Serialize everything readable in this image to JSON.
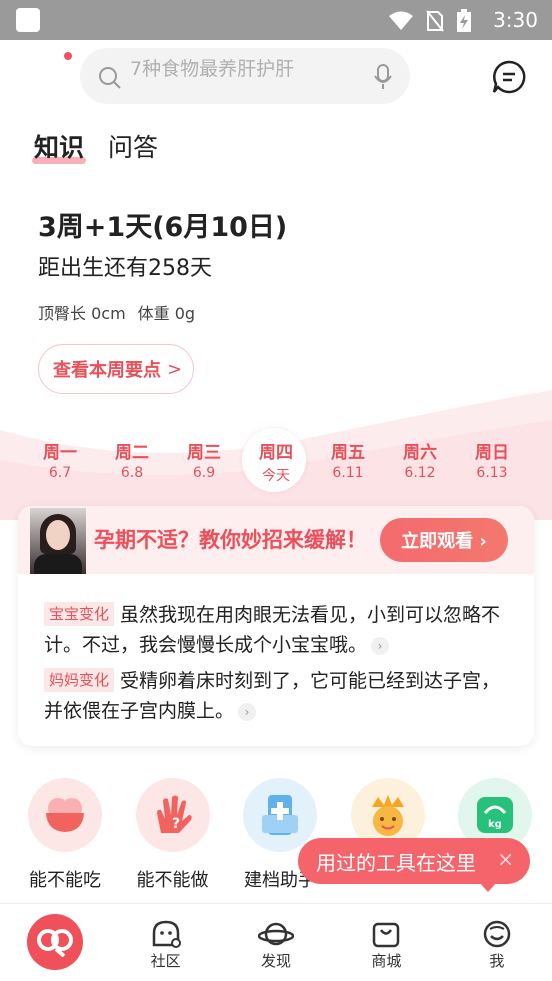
{
  "status_bar": {
    "time": "3:30"
  },
  "search": {
    "placeholder": "7种食物最养肝护肝"
  },
  "tabs": [
    {
      "label": "知识",
      "active": true
    },
    {
      "label": "问答",
      "active": false
    }
  ],
  "week": {
    "title": "3周+1天(6月10日)",
    "countdown": "距出生还有258天",
    "length_label": "顶臀长 0cm",
    "weight_label": "体重 0g",
    "button_label": "查看本周要点",
    "button_chevron": ">"
  },
  "days": [
    {
      "name": "周一",
      "date": "6.7"
    },
    {
      "name": "周二",
      "date": "6.8"
    },
    {
      "name": "周三",
      "date": "6.9"
    },
    {
      "name": "周四",
      "date": "今天",
      "today": true
    },
    {
      "name": "周五",
      "date": "6.11"
    },
    {
      "name": "周六",
      "date": "6.12"
    },
    {
      "name": "周日",
      "date": "6.13"
    }
  ],
  "banner": {
    "title": "孕期不适？教你妙招来缓解！",
    "button_label": "立即观看 ›"
  },
  "changes": {
    "baby_tag": "宝宝变化",
    "baby_text": "虽然我现在用肉眼无法看见，小到可以忽略不计。不过，我会慢慢长成个小宝宝哦。",
    "mom_tag": "妈妈变化",
    "mom_text": "受精卵着床时刻到了，它可能已经到达子宫，并依偎在子宫内膜上。",
    "more_glyph": "›"
  },
  "tools": [
    {
      "label": "能不能吃",
      "icon": "bowl-icon",
      "bg": "#fde6e6"
    },
    {
      "label": "能不能做",
      "icon": "hand-question-icon",
      "bg": "#fde6e6"
    },
    {
      "label": "建档助手",
      "icon": "medical-kit-icon",
      "bg": "#e3f1fb"
    },
    {
      "label": "",
      "icon": "baby-crown-icon",
      "bg": "#fdf0dc"
    },
    {
      "label": "",
      "icon": "scale-kg-icon",
      "bg": "#e1f6ec"
    }
  ],
  "tooltip": {
    "text": "用过的工具在这里",
    "close": "×"
  },
  "tabbar": [
    {
      "label": "",
      "icon": "home-logo-icon"
    },
    {
      "label": "社区",
      "icon": "community-icon"
    },
    {
      "label": "发现",
      "icon": "planet-icon"
    },
    {
      "label": "商城",
      "icon": "bag-icon"
    },
    {
      "label": "我",
      "icon": "face-icon"
    }
  ],
  "colors": {
    "accent": "#e8505a",
    "accent_button": "#f56a6e"
  }
}
